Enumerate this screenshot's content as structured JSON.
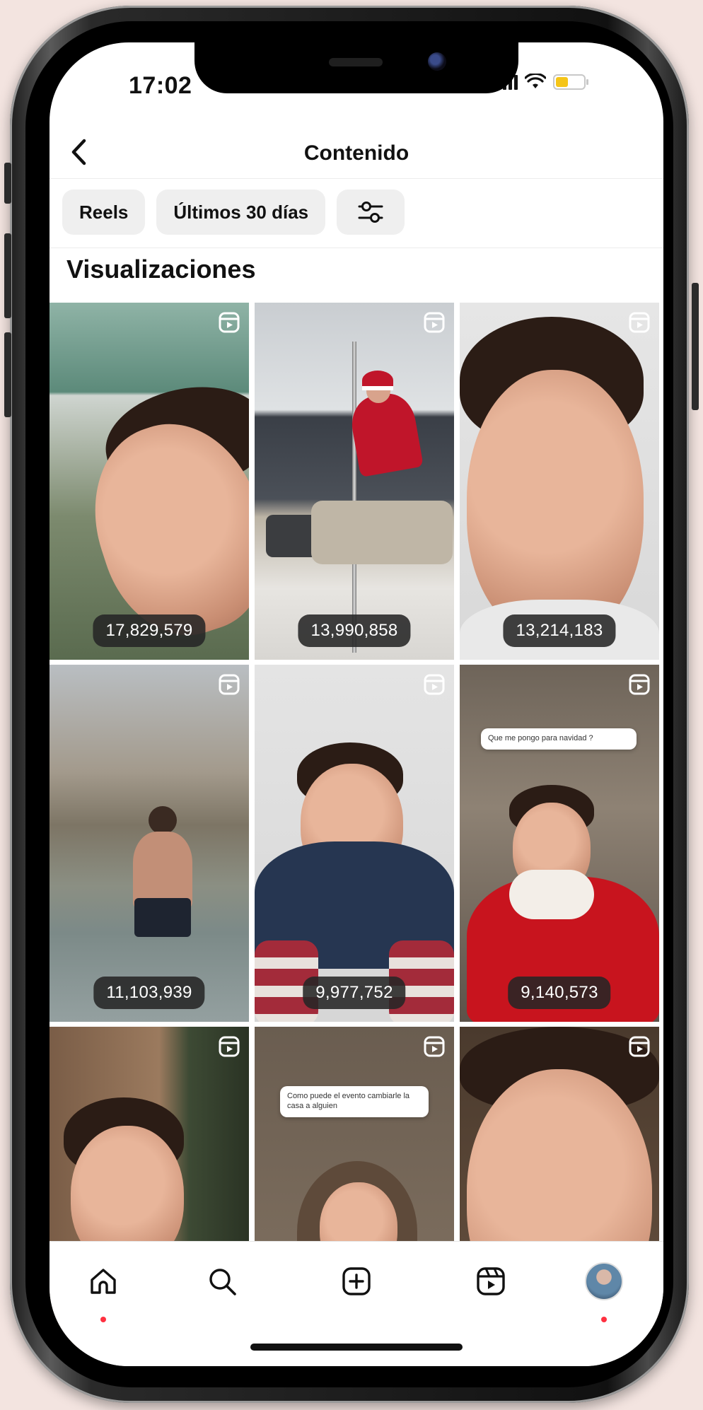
{
  "status_bar": {
    "time": "17:02"
  },
  "header": {
    "title": "Contenido"
  },
  "filters": {
    "type_label": "Reels",
    "range_label": "Últimos 30 días"
  },
  "section": {
    "title": "Visualizaciones"
  },
  "reels": [
    {
      "views": "17,829,579"
    },
    {
      "views": "13,990,858"
    },
    {
      "views": "13,214,183"
    },
    {
      "views": "11,103,939"
    },
    {
      "views": "9,977,752"
    },
    {
      "views": "9,140,573"
    },
    {
      "views": ""
    },
    {
      "views": ""
    },
    {
      "views": ""
    }
  ],
  "overlay_texts": {
    "reel6_question": "Que me pongo para navidad ? ",
    "reel8_question": "Como puede el evento cambiarle la casa a alguien"
  },
  "tab_bar": {
    "icons": [
      "home-icon",
      "search-icon",
      "create-icon",
      "reels-icon",
      "profile-avatar"
    ]
  },
  "colors": {
    "accent_dot": "#ff3040",
    "battery": "#f5c518",
    "chip_bg": "#efefef"
  }
}
